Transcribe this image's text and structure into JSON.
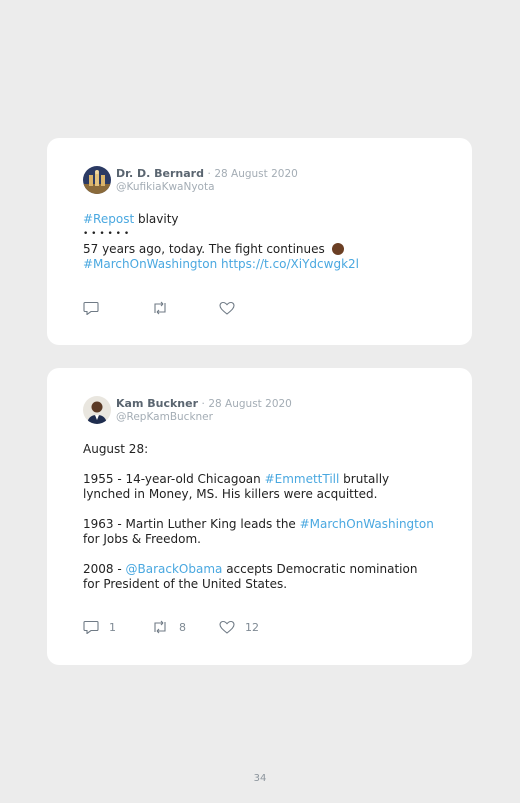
{
  "tweets": [
    {
      "author": {
        "name": "Dr. D. Bernard",
        "handle": "@KufikiaKwaNyota",
        "date": "28 August 2020",
        "separator": "·"
      },
      "body": {
        "line1_tag": "#Repost",
        "line1_text": " blavity",
        "line2": "• • • • • •",
        "line3": "57 years ago, today. The fight continues ",
        "line4_tag": "#MarchOnWashington",
        "line4_link": "https://t.co/XiYdcwgk2l"
      },
      "actions": {
        "reply_count": "",
        "retweet_count": "",
        "like_count": ""
      }
    },
    {
      "author": {
        "name": "Kam Buckner",
        "handle": "@RepKamBuckner",
        "date": "28 August 2020",
        "separator": "·"
      },
      "body": {
        "p1": "August 28:",
        "p2_a": "1955 - 14-year-old Chicagoan ",
        "p2_tag": "#EmmettTill",
        "p2_b": " brutally lynched in Money, MS. His killers were acquitted.",
        "p3_a": "1963 - Martin Luther King leads the ",
        "p3_tag": "#MarchOnWashington",
        "p3_b": " for Jobs & Freedom.",
        "p4_a": "2008 - ",
        "p4_mention": "@BarackObama",
        "p4_b": " accepts Democratic nomination for President of the United States."
      },
      "actions": {
        "reply_count": "1",
        "retweet_count": "8",
        "like_count": "12"
      }
    }
  ],
  "page_number": "34",
  "colors": {
    "background": "#ececec",
    "card": "#ffffff",
    "link": "#4aa8e0",
    "muted": "#a4adb5",
    "name": "#5a6570"
  },
  "icons": [
    "reply-icon",
    "retweet-icon",
    "like-icon"
  ]
}
